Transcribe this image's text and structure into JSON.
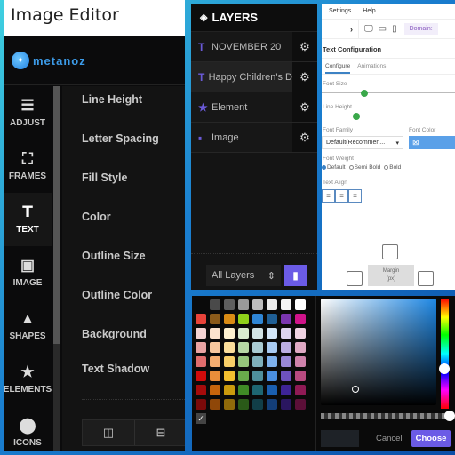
{
  "editor": {
    "title": "Image Editor",
    "logo_text": "metanoz",
    "nav": [
      {
        "label": "ADJUST",
        "icon": "sliders-icon",
        "glyph": "☰"
      },
      {
        "label": "FRAMES",
        "icon": "frame-icon",
        "glyph": "⛶"
      },
      {
        "label": "TEXT",
        "icon": "text-icon",
        "glyph": "T",
        "active": true
      },
      {
        "label": "IMAGE",
        "icon": "add-image-icon",
        "glyph": "▣"
      },
      {
        "label": "SHAPES",
        "icon": "shapes-icon",
        "glyph": "▲"
      },
      {
        "label": "ELEMENTS",
        "icon": "star-icon",
        "glyph": "★"
      },
      {
        "label": "ICONS",
        "icon": "map-pin-icon",
        "glyph": "⬤"
      }
    ],
    "properties": [
      "Line Height",
      "Letter Spacing",
      "Fill Style",
      "Color",
      "Outline Size",
      "Outline Color",
      "Background",
      "Text Shadow"
    ],
    "toolbar": [
      {
        "name": "flip-horizontal-icon",
        "glyph": "◫"
      },
      {
        "name": "flip-vertical-icon",
        "glyph": "⊟"
      }
    ]
  },
  "layers": {
    "title": "LAYERS",
    "items": [
      {
        "label": "NOVEMBER 20",
        "icon": "text-icon",
        "glyph": "T"
      },
      {
        "label": "Happy Children's D",
        "icon": "text-icon",
        "glyph": "T",
        "selected": true
      },
      {
        "label": "Element",
        "icon": "star-icon",
        "glyph": "★"
      },
      {
        "label": "Image",
        "icon": "image-icon",
        "glyph": "▪"
      }
    ],
    "filter_value": "All Layers",
    "gear_glyph": "⚙",
    "trash_glyph": "🗑"
  },
  "config": {
    "menu": [
      "Settings",
      "Help"
    ],
    "domain_label": "Domain:",
    "section_title": "Text Configuration",
    "tabs": [
      "Configure",
      "Animations"
    ],
    "active_tab": "Configure",
    "font_size_label": "Font Size",
    "font_size_value": 0.32,
    "line_height_label": "Line Height",
    "line_height_value": 0.26,
    "font_family_label": "Font Family",
    "font_family_value": "Default(Recommen...",
    "font_color_label": "Font Color",
    "font_weight_label": "Font Weight",
    "font_weights": [
      "Default",
      "Semi Bold",
      "Bold"
    ],
    "font_weight_selected": "Default",
    "text_align_label": "Text Align",
    "margin_label": "Margin",
    "margin_unit": "(px)"
  },
  "swatches": {
    "colors": [
      "#0a0a0a",
      "#4a4a4a",
      "#5e5e5e",
      "#9a9a9a",
      "#bdbdbd",
      "#ececec",
      "#f4f4f4",
      "#ffffff",
      "#e8433a",
      "#8a5a1a",
      "#d98b14",
      "#8fd11a",
      "#2f86d6",
      "#1f5f96",
      "#7a35b0",
      "#d0138a",
      "#f3d3d3",
      "#fbe3ce",
      "#fdf0cf",
      "#d9ebcf",
      "#d2e3e5",
      "#d3e6f8",
      "#ddd4ef",
      "#efd3e2",
      "#e9a3a3",
      "#f7c79e",
      "#fbde9b",
      "#b7d8a5",
      "#a9cbd2",
      "#a8cbf2",
      "#bcaee2",
      "#dfa9c4",
      "#e06c6c",
      "#f4ad70",
      "#f8cf68",
      "#96c67c",
      "#7fb0bb",
      "#7eb1ec",
      "#9988d6",
      "#cf82ab",
      "#d10b0b",
      "#e98d3a",
      "#f3bf2f",
      "#6aab4c",
      "#4f8f9c",
      "#4a8fe0",
      "#6e52c0",
      "#b84a80",
      "#a50b0b",
      "#c7650c",
      "#ca9a0d",
      "#3f8a26",
      "#1e6672",
      "#1a5fb0",
      "#3e2496",
      "#8f1a55",
      "#7a0a0a",
      "#8f4708",
      "#8f6a0a",
      "#2a5a18",
      "#113e48",
      "#133e78",
      "#2a1660",
      "#5c0f38"
    ],
    "check_glyph": "✓"
  },
  "picker": {
    "hue_position": 0.64,
    "saturation": 0.16,
    "value": 0.15,
    "alpha": 1.0,
    "cancel_label": "Cancel",
    "choose_label": "Choose"
  }
}
